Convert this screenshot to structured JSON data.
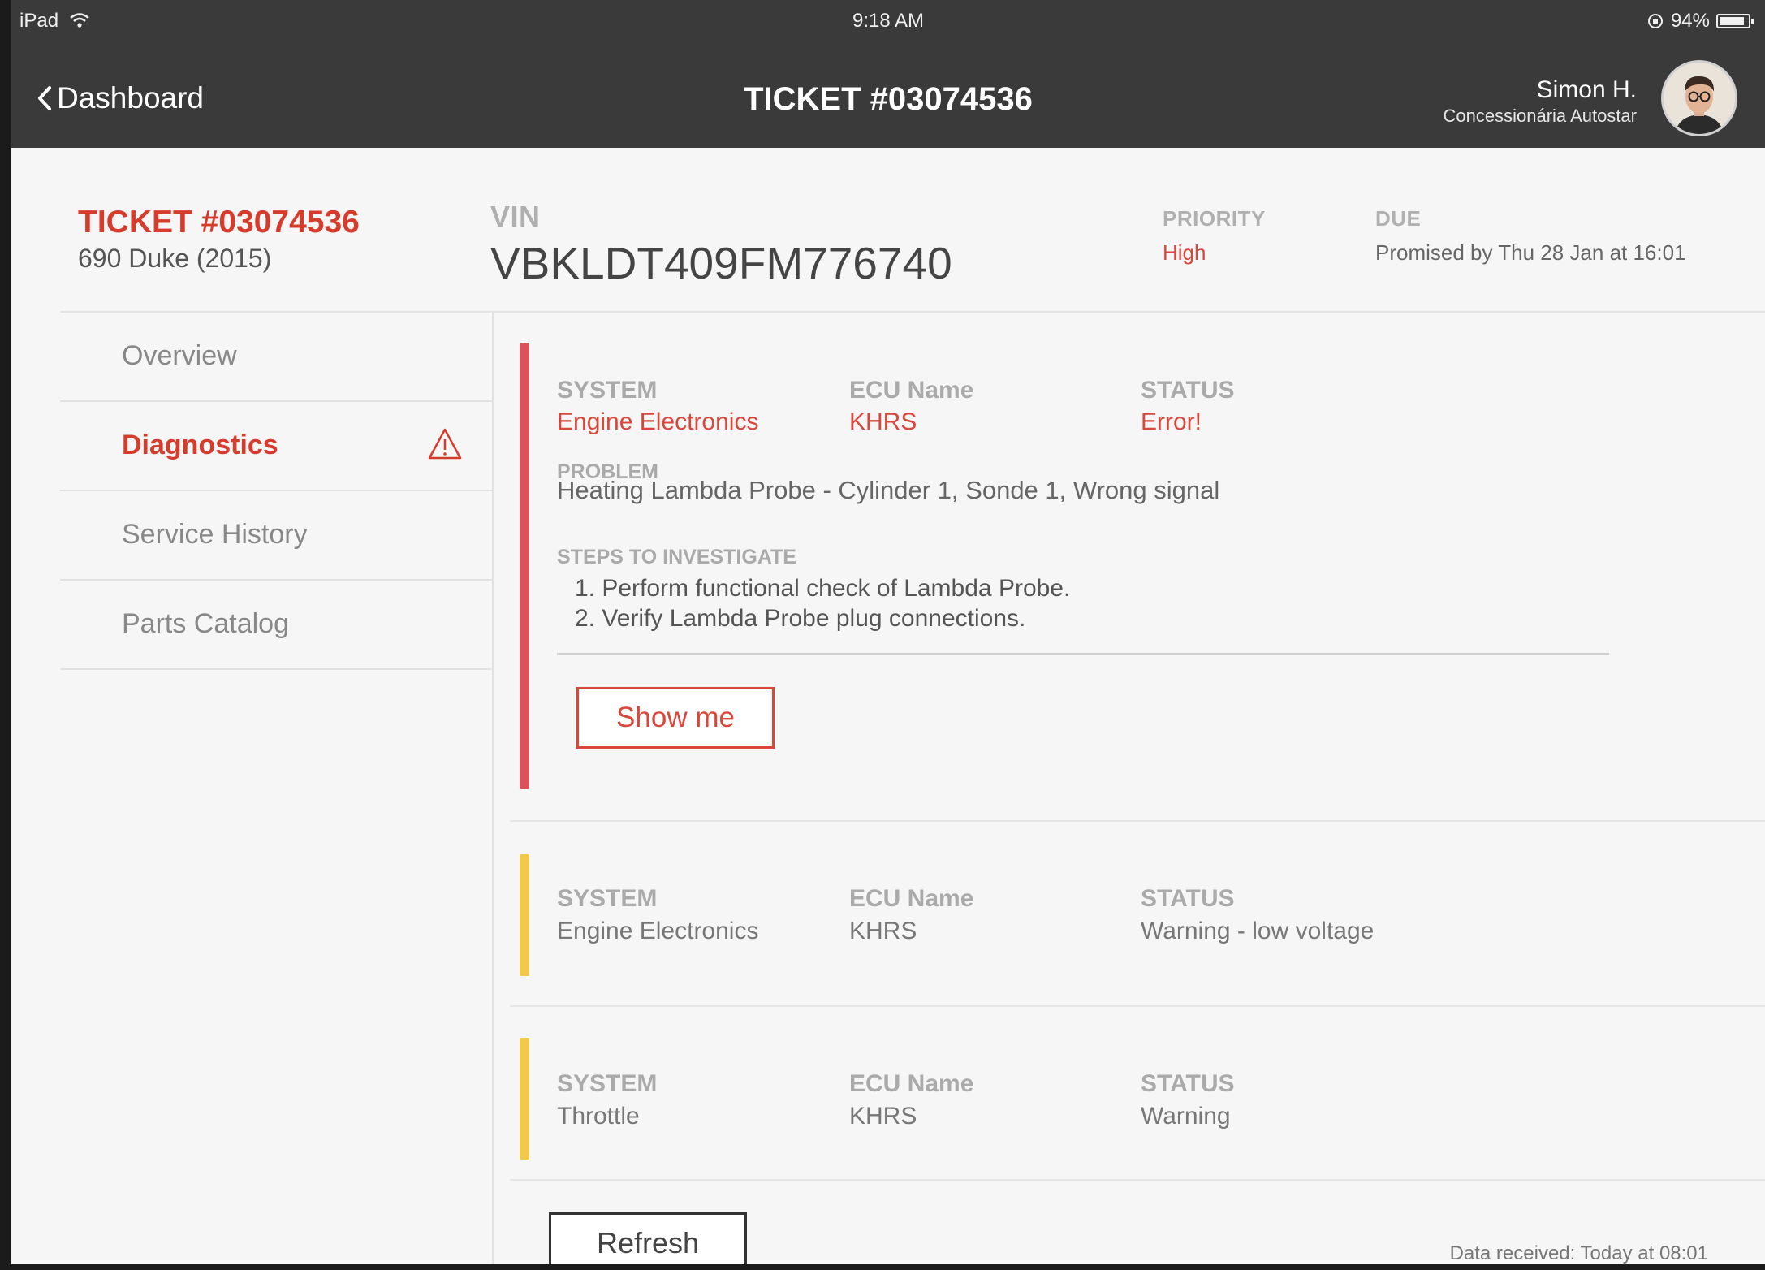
{
  "status_bar": {
    "device": "iPad",
    "time": "9:18 AM",
    "battery": "94%",
    "battery_level": 0.94
  },
  "header": {
    "back_label": "Dashboard",
    "title": "TICKET #03074536",
    "user_name": "Simon H.",
    "user_org": "Concessionária Autostar"
  },
  "summary": {
    "ticket": "TICKET #03074536",
    "vehicle": "690 Duke (2015)",
    "vin_label": "VIN",
    "vin": "VBKLDT409FM776740",
    "priority_label": "PRIORITY",
    "priority": "High",
    "due_label": "DUE",
    "due": "Promised by Thu 28 Jan at 16:01"
  },
  "sidebar": {
    "items": [
      {
        "label": "Overview"
      },
      {
        "label": "Diagnostics",
        "active": true,
        "icon": "warning-icon"
      },
      {
        "label": "Service History"
      },
      {
        "label": "Parts Catalog"
      }
    ]
  },
  "labels": {
    "system": "SYSTEM",
    "ecu": "ECU Name",
    "status": "STATUS",
    "problem": "PROBLEM",
    "steps": "STEPS TO INVESTIGATE"
  },
  "diagnostics": [
    {
      "system": "Engine Electronics",
      "ecu": "KHRS",
      "status": "Error!",
      "severity": "error",
      "problem": "Heating Lambda Probe - Cylinder 1, Sonde 1, Wrong signal",
      "steps": [
        "1. Perform functional check of Lambda Probe.",
        "2. Verify Lambda Probe plug connections."
      ],
      "action_label": "Show me"
    },
    {
      "system": "Engine Electronics",
      "ecu": "KHRS",
      "status": "Warning - low voltage",
      "severity": "warning"
    },
    {
      "system": "Throttle",
      "ecu": "KHRS",
      "status": "Warning",
      "severity": "warning"
    }
  ],
  "footer": {
    "refresh_label": "Refresh",
    "data_received": "Data received: Today at 08:01"
  },
  "colors": {
    "accent_red": "#d63c2c",
    "error_bar": "#d9535a",
    "warning_bar": "#f2c94c",
    "header_bg": "#3a3a3a"
  }
}
